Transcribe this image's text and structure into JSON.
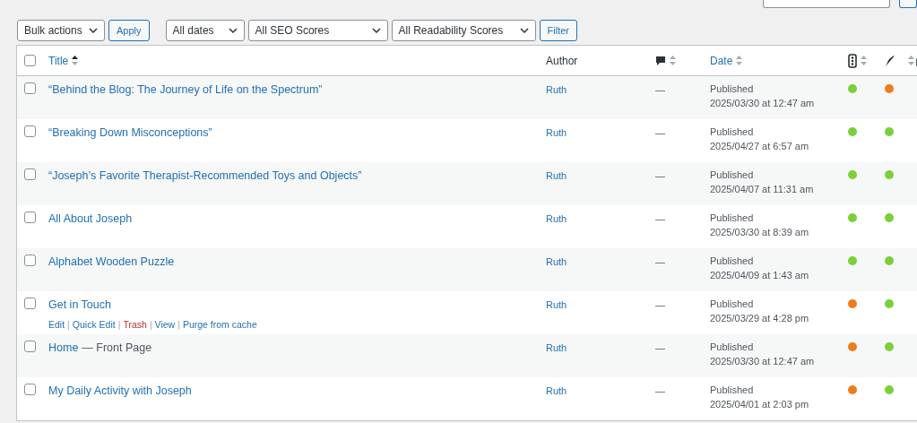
{
  "toolbar": {
    "bulk_actions": "Bulk actions",
    "apply": "Apply",
    "dates": "All dates",
    "seo": "All SEO Scores",
    "readability": "All Readability Scores",
    "filter": "Filter"
  },
  "columns": {
    "title": "Title",
    "author": "Author",
    "date": "Date",
    "select_all": {
      "checked": false
    }
  },
  "action_separator": "|",
  "rows": [
    {
      "checked": false,
      "title": "“Behind the Blog: The Journey of Life on the Spectrum”",
      "author": "Ruth",
      "comments": "—",
      "status": "Published",
      "date": "2025/03/30 at 12:47 am",
      "seo": {
        "color": "#7ad03a"
      },
      "readability": {
        "color": "#ee7c1b"
      }
    },
    {
      "checked": false,
      "title": "“Breaking Down Misconceptions”",
      "author": "Ruth",
      "comments": "—",
      "status": "Published",
      "date": "2025/04/27 at 6:57 am",
      "seo": {
        "color": "#7ad03a"
      },
      "readability": {
        "color": "#7ad03a"
      }
    },
    {
      "checked": false,
      "title": "“Joseph’s Favorite Therapist-Recommended Toys and Objects”",
      "author": "Ruth",
      "comments": "—",
      "status": "Published",
      "date": "2025/04/07 at 11:31 am",
      "seo": {
        "color": "#7ad03a"
      },
      "readability": {
        "color": "#7ad03a"
      }
    },
    {
      "checked": false,
      "title": "All About Joseph",
      "author": "Ruth",
      "comments": "—",
      "status": "Published",
      "date": "2025/03/30 at 8:39 am",
      "seo": {
        "color": "#7ad03a"
      },
      "readability": {
        "color": "#7ad03a"
      }
    },
    {
      "checked": false,
      "title": "Alphabet Wooden Puzzle",
      "author": "Ruth",
      "comments": "—",
      "status": "Published",
      "date": "2025/04/09 at 1:43 am",
      "seo": {
        "color": "#7ad03a"
      },
      "readability": {
        "color": "#7ad03a"
      }
    },
    {
      "checked": false,
      "title": "Get in Touch",
      "author": "Ruth",
      "comments": "—",
      "status": "Published",
      "date": "2025/03/29 at 4:28 pm",
      "seo": {
        "color": "#ee7c1b"
      },
      "readability": {
        "color": "#7ad03a"
      },
      "actions": [
        {
          "label": "Edit",
          "kind": "normal"
        },
        {
          "label": "Quick Edit",
          "kind": "normal"
        },
        {
          "label": "Trash",
          "kind": "delete"
        },
        {
          "label": "View",
          "kind": "normal"
        },
        {
          "label": "Purge from cache",
          "kind": "normal"
        }
      ]
    },
    {
      "checked": false,
      "title": "Home",
      "state": "— Front Page",
      "author": "Ruth",
      "comments": "—",
      "status": "Published",
      "date": "2025/03/30 at 12:47 am",
      "seo": {
        "color": "#ee7c1b"
      },
      "readability": {
        "color": "#7ad03a"
      }
    },
    {
      "checked": false,
      "title": "My Daily Activity with Joseph",
      "author": "Ruth",
      "comments": "—",
      "status": "Published",
      "date": "2025/04/01 at 2:03 pm",
      "seo": {
        "color": "#ee7c1b"
      },
      "readability": {
        "color": "#7ad03a"
      }
    }
  ]
}
